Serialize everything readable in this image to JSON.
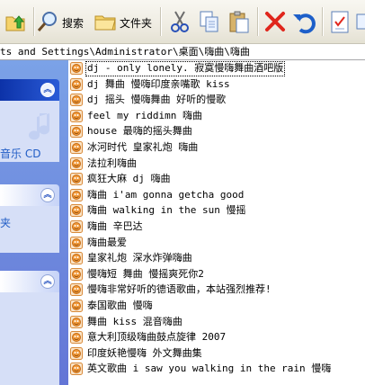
{
  "toolbar": {
    "search_label": "搜索",
    "folders_label": "文件夹",
    "icons": [
      "up-folder-icon",
      "search-icon",
      "folders-icon",
      "cut-icon",
      "copy-icon",
      "paste-icon",
      "delete-icon",
      "undo-icon",
      "properties-icon"
    ]
  },
  "address": {
    "path": "ts and Settings\\Administrator\\桌面\\嗨曲\\嗨曲"
  },
  "taskpane": {
    "panel1_text": "音乐 CD",
    "panel2_text": "夹"
  },
  "files": [
    "dj - only lonely. 寂寞慢嗨舞曲酒吧版",
    "dj 舞曲 慢嗨印度亲嘴歌 kiss",
    "dj 摇头 慢嗨舞曲 好听的慢歌",
    "feel my riddimn 嗨曲",
    "house 最嗨的摇头舞曲",
    "冰河时代 皇家礼炮 嗨曲",
    "法拉利嗨曲",
    "疯狂大麻 dj 嗨曲",
    "嗨曲 i'am gonna getcha good",
    "嗨曲 walking in the sun 慢摇",
    "嗨曲 辛巴达",
    "嗨曲最爱",
    "皇家礼炮 深水炸弹嗨曲",
    "慢嗨短 舞曲 慢摇爽死你2",
    "慢嗨非常好听的德语歌曲，本站强烈推荐!",
    "泰国歌曲 慢嗨",
    "舞曲 kiss 混音嗨曲",
    "意大利顶级嗨曲鼓点旋律 2007",
    "印度妖艳慢嗨 外文舞曲集",
    "英文歌曲 i saw you walking in the rain 慢嗨"
  ],
  "colors": {
    "taskpane_gradient_top": "#7ba2e7",
    "taskpane_gradient_bottom": "#6375d6",
    "delete_red": "#e0261c",
    "undo_blue": "#1d5fc9"
  }
}
